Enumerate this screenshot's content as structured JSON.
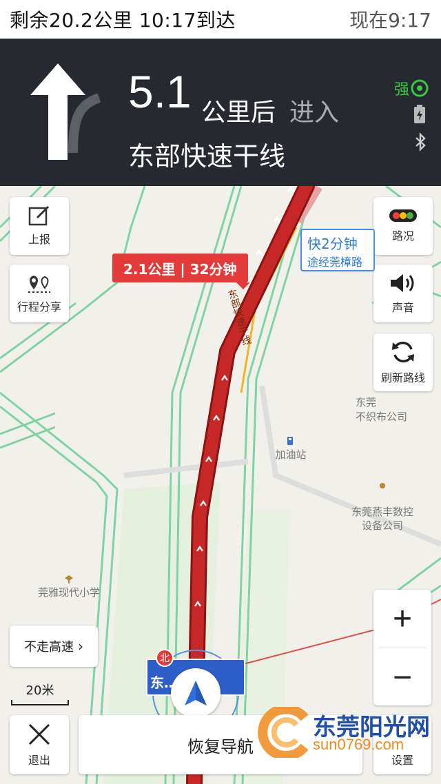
{
  "status_bar": {
    "remaining": "剩余20.2公里  10:17到达",
    "now": "现在9:17"
  },
  "guidance": {
    "distance": "5.1",
    "distance_unit": "公里后",
    "action": "进入",
    "road": "东部快速干线",
    "signal_label": "强"
  },
  "map": {
    "left_buttons": [
      {
        "label": "上报",
        "icon": "edit-icon"
      },
      {
        "label": "行程分享",
        "icon": "share-route-icon"
      }
    ],
    "right_buttons": [
      {
        "label": "路况",
        "icon": "traffic-light-icon"
      },
      {
        "label": "声音",
        "icon": "speaker-icon"
      },
      {
        "label": "刷新路线",
        "icon": "refresh-icon"
      }
    ],
    "route_tag": "2.1公里 | 32分钟",
    "alt_route": {
      "line1": "快2分钟",
      "line2": "途经莞樟路"
    },
    "road_label": "东部快速干线",
    "pois": [
      {
        "name": "加油站"
      },
      {
        "name": "东莞燕丰数控\n设备公司"
      },
      {
        "name": "东莞\n不织布公司"
      },
      {
        "name": "莞雅现代小学"
      }
    ],
    "avoid_highway": "不走高速",
    "scale": "20米",
    "zoom_in": "+",
    "zoom_out": "−",
    "road_sign": "东…         路区",
    "north": "北"
  },
  "bottom": {
    "exit": "退出",
    "resume": "恢复导航",
    "settings": "设置"
  },
  "watermark": {
    "cn": "东莞阳光网",
    "url": "sun0769.com"
  },
  "colors": {
    "route_red": "#c62828",
    "guide_bg": "#262a30",
    "signal_green": "#3bc743",
    "accent_blue": "#2f7ad6"
  }
}
